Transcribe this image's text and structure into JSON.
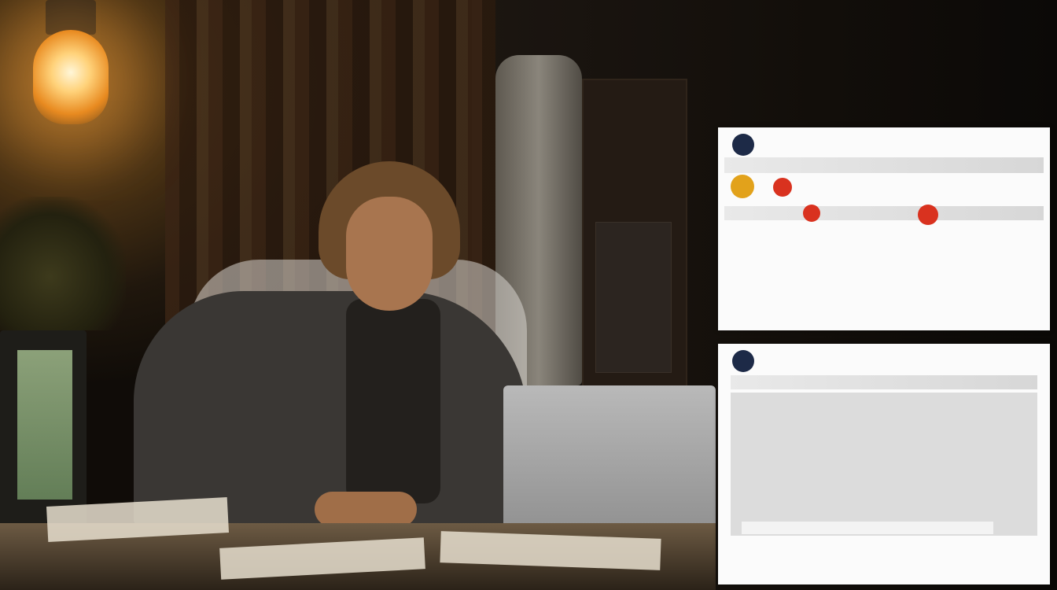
{
  "overlay": {
    "headline": "",
    "subheadline": ""
  },
  "cards": [
    {
      "rows": [
        "",
        "",
        "",
        "",
        "",
        "",
        ""
      ]
    },
    {
      "rows": [
        "",
        "",
        "",
        "",
        "",
        "",
        "",
        ""
      ]
    }
  ],
  "colors": {
    "lamp_glow": "#ffd27a",
    "avatar": "#1d2a47",
    "card_bg": "#fbfbfb",
    "accent_red": "#d9321f",
    "accent_orange": "#e2a21b"
  }
}
